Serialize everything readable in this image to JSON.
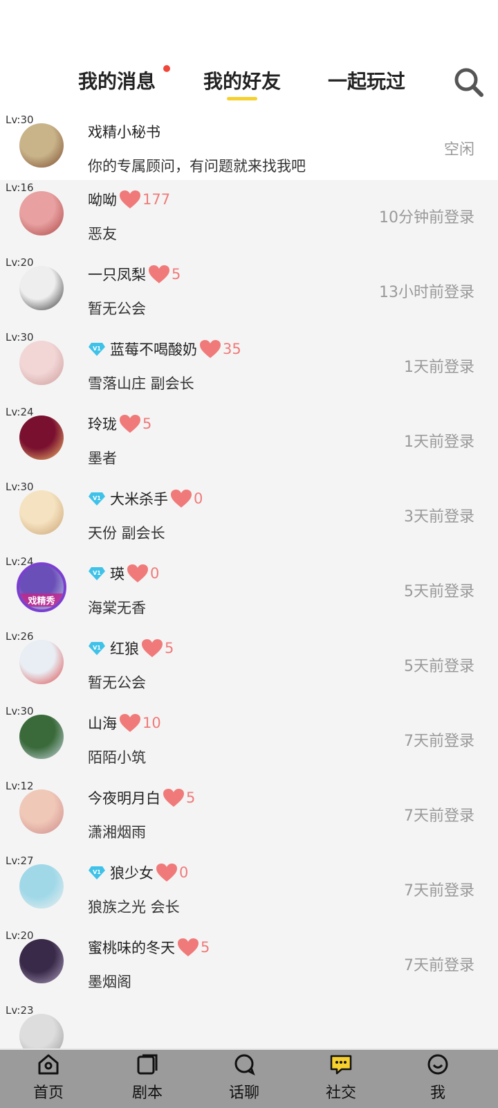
{
  "tabs": {
    "messages": "我的消息",
    "friends": "我的好友",
    "played": "一起玩过"
  },
  "colors": {
    "accent": "#f6d02e",
    "heart": "#f07a7a",
    "unread_dot": "#f0473a",
    "nav_bg": "#9b9b9b"
  },
  "friends": [
    {
      "level": "Lv:30",
      "name": "戏精小秘书",
      "sub": "你的专属顾问，有问题就来找我吧",
      "status": "空闲",
      "vip": false,
      "heart": null,
      "avatar": "assistant-avatar"
    },
    {
      "level": "Lv:16",
      "name": "呦呦",
      "sub": "恶友",
      "status": "10分钟前登录",
      "vip": false,
      "heart": "177",
      "avatar": "user-avatar"
    },
    {
      "level": "Lv:20",
      "name": "一只凤梨",
      "sub": "暂无公会",
      "status": "13小时前登录",
      "vip": false,
      "heart": "5",
      "avatar": "user-avatar"
    },
    {
      "level": "Lv:30",
      "name": "蓝莓不喝酸奶",
      "sub": "雪落山庄 副会长",
      "status": "1天前登录",
      "vip": true,
      "heart": "35",
      "avatar": "user-avatar"
    },
    {
      "level": "Lv:24",
      "name": "玲珑",
      "sub": "墨者",
      "status": "1天前登录",
      "vip": false,
      "heart": "5",
      "avatar": "user-avatar"
    },
    {
      "level": "Lv:30",
      "name": "大米杀手",
      "sub": "天份 副会长",
      "status": "3天前登录",
      "vip": true,
      "heart": "0",
      "avatar": "user-avatar"
    },
    {
      "level": "Lv:24",
      "name": "瑛",
      "sub": "海棠无香",
      "status": "5天前登录",
      "vip": true,
      "heart": "0",
      "avatar": "user-avatar",
      "avatar_badge": "戏精秀"
    },
    {
      "level": "Lv:26",
      "name": "红狼",
      "sub": "暂无公会",
      "status": "5天前登录",
      "vip": true,
      "heart": "5",
      "avatar": "user-avatar"
    },
    {
      "level": "Lv:30",
      "name": "山海",
      "sub": "陌陌小筑",
      "status": "7天前登录",
      "vip": false,
      "heart": "10",
      "avatar": "user-avatar"
    },
    {
      "level": "Lv:12",
      "name": "今夜明月白",
      "sub": "潇湘烟雨",
      "status": "7天前登录",
      "vip": false,
      "heart": "5",
      "avatar": "user-avatar"
    },
    {
      "level": "Lv:27",
      "name": "狼少女",
      "sub": "狼族之光 会长",
      "status": "7天前登录",
      "vip": true,
      "heart": "0",
      "avatar": "user-avatar"
    },
    {
      "level": "Lv:20",
      "name": "蜜桃味的冬天",
      "sub": "墨烟阁",
      "status": "7天前登录",
      "vip": false,
      "heart": "5",
      "avatar": "user-avatar"
    },
    {
      "level": "Lv:23",
      "name": "",
      "sub": "",
      "status": "",
      "vip": false,
      "heart": null,
      "avatar": "user-avatar"
    }
  ],
  "bottom_nav": [
    {
      "label": "首页",
      "icon": "home-icon"
    },
    {
      "label": "剧本",
      "icon": "script-icon"
    },
    {
      "label": "话聊",
      "icon": "chat-icon"
    },
    {
      "label": "社交",
      "icon": "social-icon",
      "active": true
    },
    {
      "label": "我",
      "icon": "profile-icon"
    }
  ]
}
